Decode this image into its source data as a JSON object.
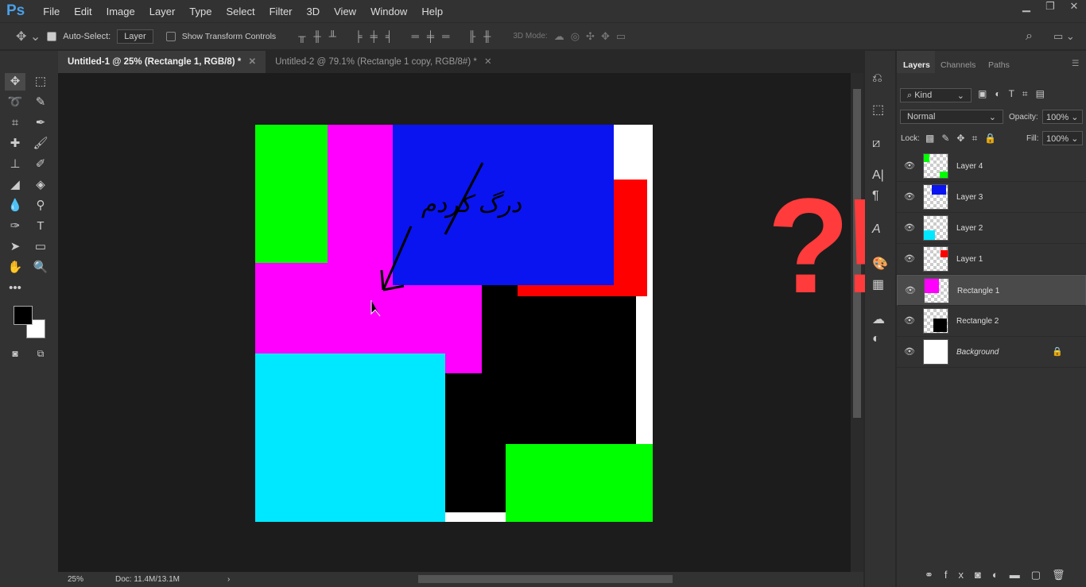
{
  "menubar": {
    "logo": "Ps",
    "items": [
      "File",
      "Edit",
      "Image",
      "Layer",
      "Type",
      "Select",
      "Filter",
      "3D",
      "View",
      "Window",
      "Help"
    ]
  },
  "options": {
    "auto_select_label": "Auto-Select:",
    "auto_select_checked": true,
    "auto_select_value": "Layer",
    "show_transform_label": "Show Transform Controls",
    "show_transform_checked": false,
    "mode_3d_label": "3D Mode:"
  },
  "tabs": [
    {
      "label": "Untitled-1 @ 25% (Rectangle 1, RGB/8) *",
      "active": true
    },
    {
      "label": "Untitled-2 @ 79.1% (Rectangle 1 copy, RGB/8#) *",
      "active": false
    }
  ],
  "status": {
    "zoom": "25%",
    "doc": "Doc: 11.4M/13.1M"
  },
  "layers_panel": {
    "tabs": [
      "Layers",
      "Channels",
      "Paths"
    ],
    "filter": "Kind",
    "blend_mode": "Normal",
    "opacity_label": "Opacity:",
    "opacity": "100%",
    "lock_label": "Lock:",
    "fill_label": "Fill:",
    "fill": "100%",
    "layers": [
      {
        "name": "Layer 4",
        "selected": false
      },
      {
        "name": "Layer 3",
        "selected": false
      },
      {
        "name": "Layer 2",
        "selected": false
      },
      {
        "name": "Layer 1",
        "selected": false
      },
      {
        "name": "Rectangle 1",
        "selected": true
      },
      {
        "name": "Rectangle 2",
        "selected": false
      },
      {
        "name": "Background",
        "selected": false,
        "locked": true
      }
    ]
  },
  "annotations": {
    "handwriting": "درگ کردم",
    "marks": "?!",
    "color": "#ff3b3b"
  },
  "colors": {
    "magenta": "#ff00ff",
    "blue": "#0a14f0",
    "green": "#00ff00",
    "cyan": "#00e8ff",
    "red": "#ff0000",
    "black": "#000000"
  }
}
